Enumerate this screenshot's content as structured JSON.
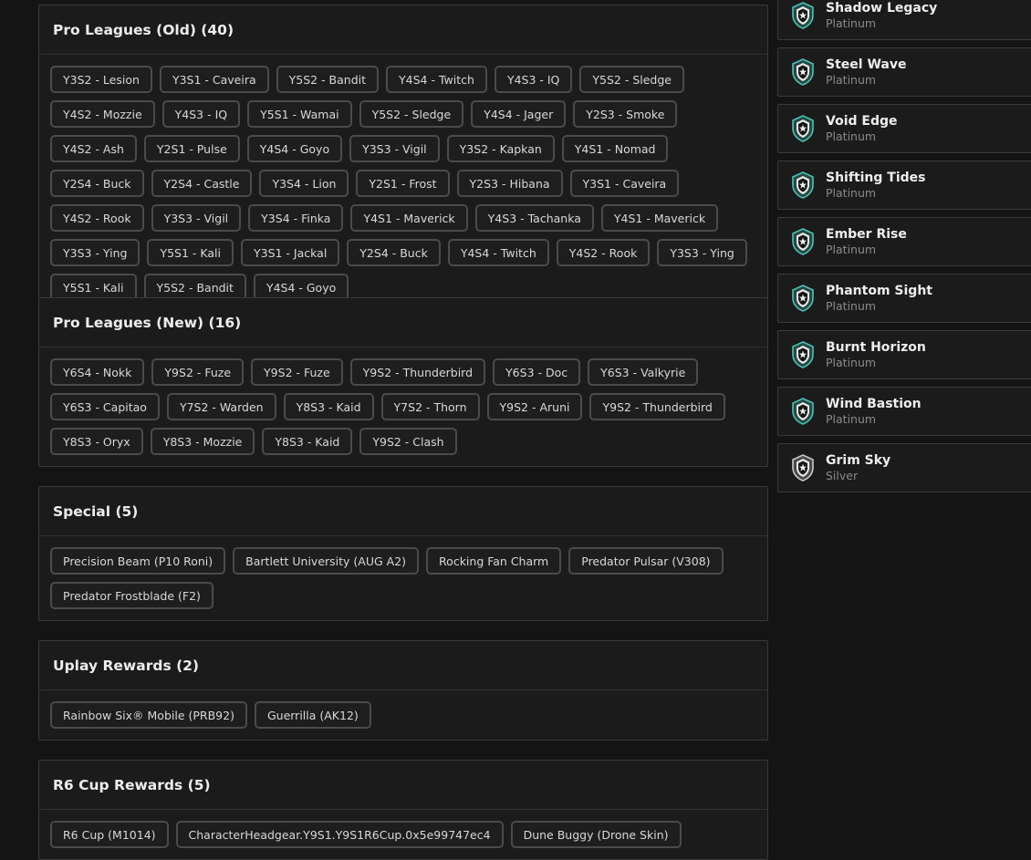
{
  "sections": [
    {
      "title": "Pro Leagues (Old) (40)",
      "items": [
        "Y3S2 - Lesion",
        "Y3S1 - Caveira",
        "Y5S2 - Bandit",
        "Y4S4 - Twitch",
        "Y4S3 - IQ",
        "Y5S2 - Sledge",
        "Y4S2 - Mozzie",
        "Y4S3 - IQ",
        "Y5S1 - Wamai",
        "Y5S2 - Sledge",
        "Y4S4 - Jager",
        "Y2S3 - Smoke",
        "Y4S2 - Ash",
        "Y2S1 - Pulse",
        "Y4S4 - Goyo",
        "Y3S3 - Vigil",
        "Y3S2 - Kapkan",
        "Y4S1 - Nomad",
        "Y2S4 - Buck",
        "Y2S4 - Castle",
        "Y3S4 - Lion",
        "Y2S1 - Frost",
        "Y2S3 - Hibana",
        "Y3S1 - Caveira",
        "Y4S2 - Rook",
        "Y3S3 - Vigil",
        "Y3S4 - Finka",
        "Y4S1 - Maverick",
        "Y4S3 - Tachanka",
        "Y4S1 - Maverick",
        "Y3S3 - Ying",
        "Y5S1 - Kali",
        "Y3S1 - Jackal",
        "Y2S4 - Buck",
        "Y4S4 - Twitch",
        "Y4S2 - Rook",
        "Y3S3 - Ying",
        "Y5S1 - Kali",
        "Y5S2 - Bandit",
        "Y4S4 - Goyo"
      ]
    },
    {
      "title": "Pro Leagues (New) (16)",
      "items": [
        "Y6S4 - Nokk",
        "Y9S2 - Fuze",
        "Y9S2 - Fuze",
        "Y9S2 - Thunderbird",
        "Y6S3 - Doc",
        "Y6S3 - Valkyrie",
        "Y6S3 - Capitao",
        "Y7S2 - Warden",
        "Y8S3 - Kaid",
        "Y7S2 - Thorn",
        "Y9S2 - Aruni",
        "Y9S2 - Thunderbird",
        "Y8S3 - Oryx",
        "Y8S3 - Mozzie",
        "Y8S3 - Kaid",
        "Y9S2 - Clash"
      ]
    },
    {
      "title": "Special (5)",
      "items": [
        "Precision Beam (P10 Roni)",
        "Bartlett University (AUG A2)",
        "Rocking Fan Charm",
        "Predator Pulsar (V308)",
        "Predator Frostblade (F2)"
      ]
    },
    {
      "title": "Uplay Rewards (2)",
      "items": [
        "Rainbow Six® Mobile (PRB92)",
        "Guerrilla (AK12)"
      ]
    },
    {
      "title": "R6 Cup Rewards (5)",
      "items": [
        "R6 Cup (M1014)",
        "CharacterHeadgear.Y9S1.Y9S1R6Cup.0x5e99747ec4",
        "Dune Buggy (Drone Skin)"
      ]
    }
  ],
  "ranks": [
    {
      "name": "Shadow Legacy",
      "tier": "Platinum",
      "icon": "platinum-rank-icon"
    },
    {
      "name": "Steel Wave",
      "tier": "Platinum",
      "icon": "platinum-rank-icon"
    },
    {
      "name": "Void Edge",
      "tier": "Platinum",
      "icon": "platinum-rank-icon"
    },
    {
      "name": "Shifting Tides",
      "tier": "Platinum",
      "icon": "platinum-rank-icon"
    },
    {
      "name": "Ember Rise",
      "tier": "Platinum",
      "icon": "platinum-rank-icon"
    },
    {
      "name": "Phantom Sight",
      "tier": "Platinum",
      "icon": "platinum-rank-icon"
    },
    {
      "name": "Burnt Horizon",
      "tier": "Platinum",
      "icon": "platinum-rank-icon"
    },
    {
      "name": "Wind Bastion",
      "tier": "Platinum",
      "icon": "platinum-rank-icon"
    },
    {
      "name": "Grim Sky",
      "tier": "Silver",
      "icon": "silver-rank-icon"
    }
  ],
  "colors": {
    "background": "#141414",
    "card": "#1b1b1b",
    "border": "#3a3a3a",
    "platinum": "#49c3b2",
    "silver": "#c8c8c8"
  }
}
